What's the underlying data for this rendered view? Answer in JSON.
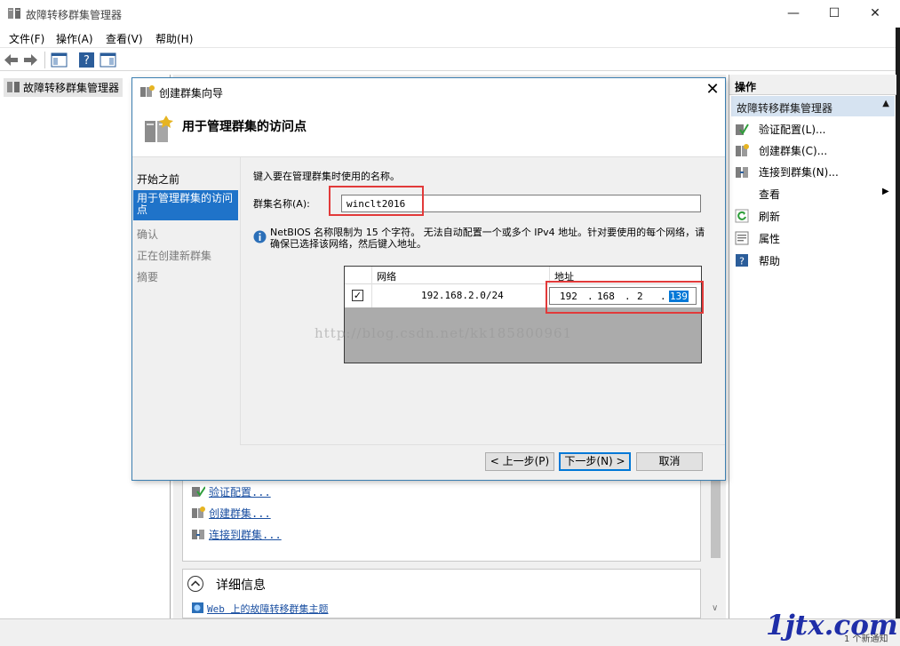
{
  "window": {
    "title": "故障转移群集管理器",
    "min_glyph": "—",
    "max_glyph": "☐",
    "close_glyph": "✕"
  },
  "menu": {
    "items": [
      {
        "label": "文件(F)"
      },
      {
        "label": "操作(A)"
      },
      {
        "label": "查看(V)"
      },
      {
        "label": "帮助(H)"
      }
    ]
  },
  "toolbar": {
    "icons": [
      "back-arrow-icon",
      "forward-arrow-icon",
      "show-tree-icon",
      "help-icon",
      "show-action-pane-icon"
    ]
  },
  "tree": {
    "root_label": "故障转移群集管理器"
  },
  "actions": {
    "header": "操作",
    "group_label": "故障转移群集管理器",
    "items": [
      {
        "label": "验证配置(L)...",
        "icon": "validate-icon"
      },
      {
        "label": "创建群集(C)...",
        "icon": "create-cluster-icon"
      },
      {
        "label": "连接到群集(N)...",
        "icon": "connect-cluster-icon"
      },
      {
        "label": "查看",
        "icon": "none"
      },
      {
        "label": "刷新",
        "icon": "refresh-icon"
      },
      {
        "label": "属性",
        "icon": "properties-icon"
      },
      {
        "label": "帮助",
        "icon": "help-icon"
      }
    ]
  },
  "center": {
    "links": [
      {
        "label": "验证配置..."
      },
      {
        "label": "创建群集..."
      },
      {
        "label": "连接到群集..."
      }
    ],
    "details_title": "详细信息",
    "web_link": "Web 上的故障转移群集主题"
  },
  "dialog": {
    "title": "创建群集向导",
    "heading": "用于管理群集的访问点",
    "steps": [
      {
        "label": "开始之前",
        "state": "done"
      },
      {
        "label": "用于管理群集的访问点",
        "state": "active"
      },
      {
        "label": "确认",
        "state": "pending"
      },
      {
        "label": "正在创建新群集",
        "state": "pending"
      },
      {
        "label": "摘要",
        "state": "pending"
      }
    ],
    "prompt": "键入要在管理群集时使用的名称。",
    "name_label": "群集名称(A):",
    "name_value": "winclt2016",
    "info_text": "NetBIOS 名称限制为 15 个字符。 无法自动配置一个或多个 IPv4 地址。针对要使用的每个网络，请确保已选择该网络，然后键入地址。",
    "grid": {
      "col_network": "网络",
      "col_address": "地址",
      "rows": [
        {
          "checked": true,
          "network": "192.168.2.0/24",
          "ip": [
            "192",
            "168",
            "2",
            "139"
          ]
        }
      ]
    },
    "buttons": {
      "prev": "< 上一步(P)",
      "next": "下一步(N) >",
      "cancel": "取消"
    }
  },
  "watermark": "http://blog.csdn.net/kk185800961",
  "brand": "1jtx.com",
  "status_text": "1 个新通知",
  "colors": {
    "accent": "#1f73c9",
    "highlight_box": "#e23a3a",
    "action_group_bg": "#d6e3f1"
  }
}
